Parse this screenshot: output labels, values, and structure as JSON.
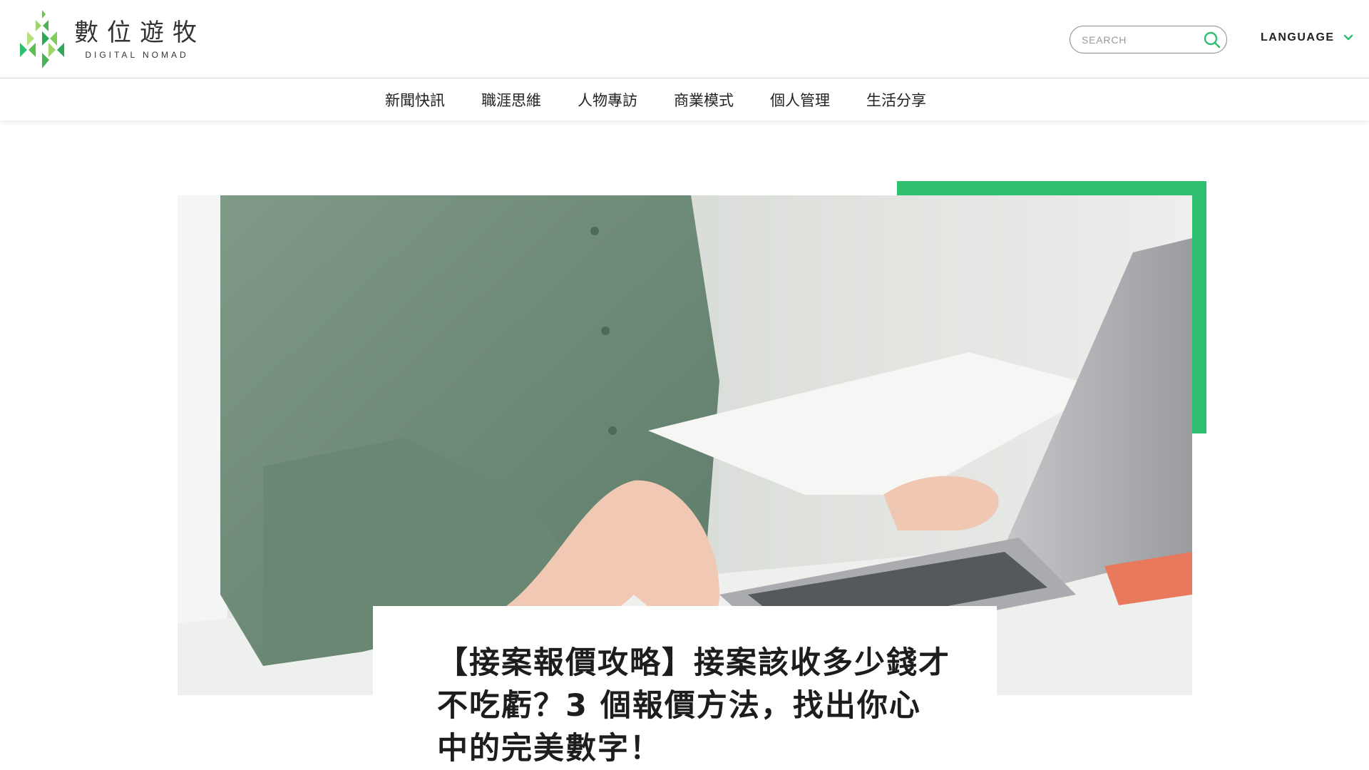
{
  "brand": {
    "name_cn": "數位遊牧",
    "name_en": "DIGITAL NOMAD",
    "accent_color": "#2fbf71"
  },
  "search": {
    "placeholder": "SEARCH",
    "icon": "search-icon"
  },
  "language": {
    "label": "LANGUAGE",
    "icon": "chevron-down-icon"
  },
  "nav": {
    "items": [
      {
        "label": "新聞快訊"
      },
      {
        "label": "職涯思維"
      },
      {
        "label": "人物專訪"
      },
      {
        "label": "商業模式"
      },
      {
        "label": "個人管理"
      },
      {
        "label": "生活分享"
      }
    ]
  },
  "article": {
    "title": "【接案報價攻略】接案該收多少錢才不吃虧？3 個報價方法，找出你心中的完美數字！"
  }
}
